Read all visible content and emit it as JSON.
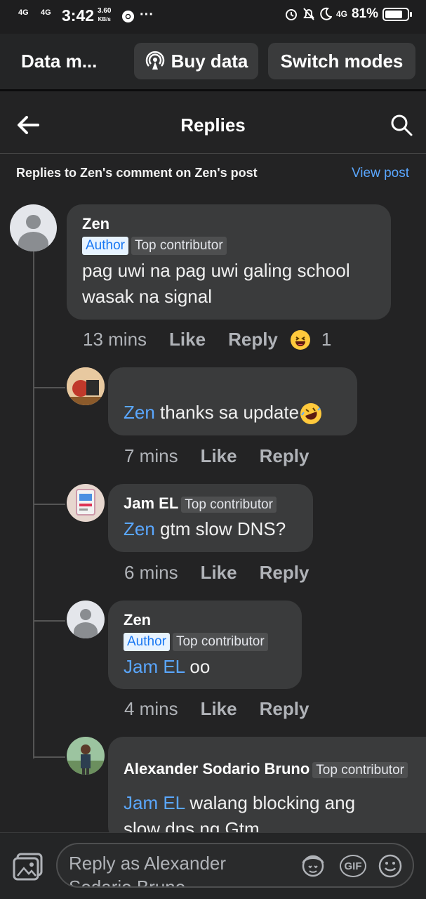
{
  "status_bar": {
    "sig1": "4G",
    "sig2": "4G",
    "time": "3:42",
    "speed_value": "3.60",
    "speed_unit": "KB/s",
    "dots": "···",
    "net": "4G",
    "battery": "81%",
    "battery_level": 0.81
  },
  "data_mode": {
    "title": "Data m...",
    "buy_label": "Buy data",
    "switch_label": "Switch modes"
  },
  "header": {
    "title": "Replies",
    "subtitle": "Replies to Zen's comment on Zen's post",
    "view_post": "View post"
  },
  "comments": [
    {
      "name": "Zen",
      "author_badge": "Author",
      "top_badge": "Top contributor",
      "text_line1": "pag uwi na pag uwi galing school",
      "text_line2": "wasak na signal",
      "time": "13 mins",
      "like": "Like",
      "reply": "Reply",
      "reaction_count": "1"
    },
    {
      "mention": "Zen",
      "text": " thanks sa update",
      "time": "7 mins",
      "like": "Like",
      "reply": "Reply"
    },
    {
      "name": "Jam EL",
      "top_badge": "Top contributor",
      "mention": "Zen",
      "text": " gtm slow DNS?",
      "time": "6 mins",
      "like": "Like",
      "reply": "Reply"
    },
    {
      "name": "Zen",
      "author_badge": "Author",
      "top_badge": "Top contributor",
      "mention": "Jam EL",
      "text": " oo",
      "time": "4 mins",
      "like": "Like",
      "reply": "Reply"
    },
    {
      "name": "Alexander Sodario Bruno",
      "top_badge": "Top contributor",
      "mention": "Jam EL",
      "text_line1": " walang blocking ang",
      "text_line2": "slow dns ng Gtm"
    }
  ],
  "composer": {
    "placeholder": "Reply as Alexander Sodario Bruno",
    "gif": "GIF"
  },
  "icons": [
    "back-arrow-icon",
    "search-icon",
    "buy-data-icon",
    "photo-icon",
    "avatar-sticker-icon",
    "gif-icon",
    "emoji-icon",
    "alarm-icon",
    "mute-icon",
    "moon-icon",
    "chrome-icon"
  ]
}
